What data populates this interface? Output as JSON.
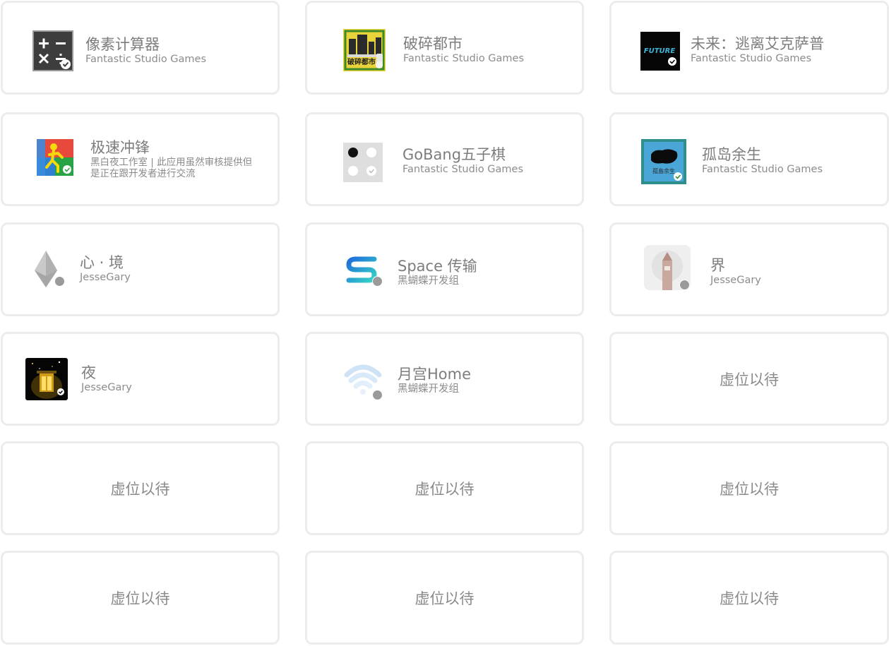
{
  "apps": [
    {
      "title": "像素计算器",
      "developer": "Fantastic Studio Games",
      "icon": "calculator-icon"
    },
    {
      "title": "破碎都市",
      "developer": "Fantastic Studio Games",
      "icon": "city-icon"
    },
    {
      "title": "未来：逃离艾克萨普",
      "developer": "Fantastic Studio Games",
      "icon": "future-icon"
    },
    {
      "title": "极速冲锋",
      "developer": "黑白夜工作室 | 此应用虽然审核提供但是正在跟开发者进行交流",
      "icon": "runner-icon"
    },
    {
      "title": "GoBang五子棋",
      "developer": "Fantastic Studio Games",
      "icon": "gobang-icon"
    },
    {
      "title": "孤岛余生",
      "developer": "Fantastic Studio Games",
      "icon": "island-icon"
    },
    {
      "title": "心 · 境",
      "developer": "JesseGary",
      "icon": "crystal-icon"
    },
    {
      "title": "Space 传输",
      "developer": "黑蝴蝶开发组",
      "icon": "space-transfer-icon"
    },
    {
      "title": "界",
      "developer": "JesseGary",
      "icon": "tower-icon"
    },
    {
      "title": "夜",
      "developer": "JesseGary",
      "icon": "night-gate-icon"
    },
    {
      "title": "月宫Home",
      "developer": "黑蝴蝶开发组",
      "icon": "wifi-home-icon"
    }
  ],
  "placeholder_label": "虚位以待",
  "icon_text": {
    "city": "破碎都市",
    "future": "FUTURE",
    "island": "孤島余生"
  },
  "colors": {
    "card_border": "#ececec",
    "title_text": "#7d7d7d",
    "subtitle_text": "#8c8c8c",
    "badge": "#9a9a9a"
  }
}
